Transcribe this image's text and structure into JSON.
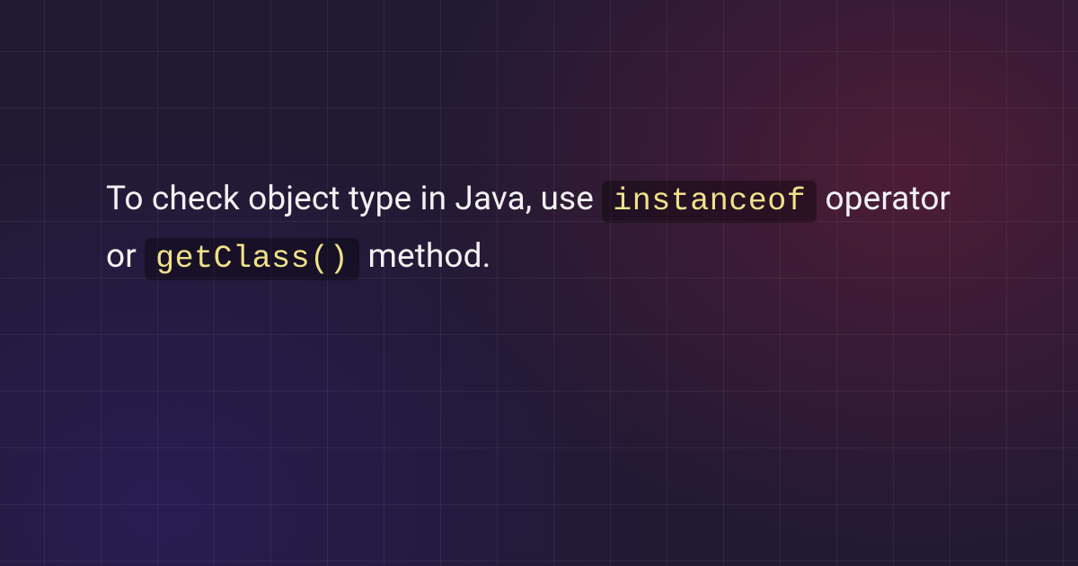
{
  "passage": {
    "part1": "To check object type in Java, use ",
    "code1": "instanceof",
    "part2": " operator or ",
    "code2": "getClass()",
    "part3": " method."
  }
}
